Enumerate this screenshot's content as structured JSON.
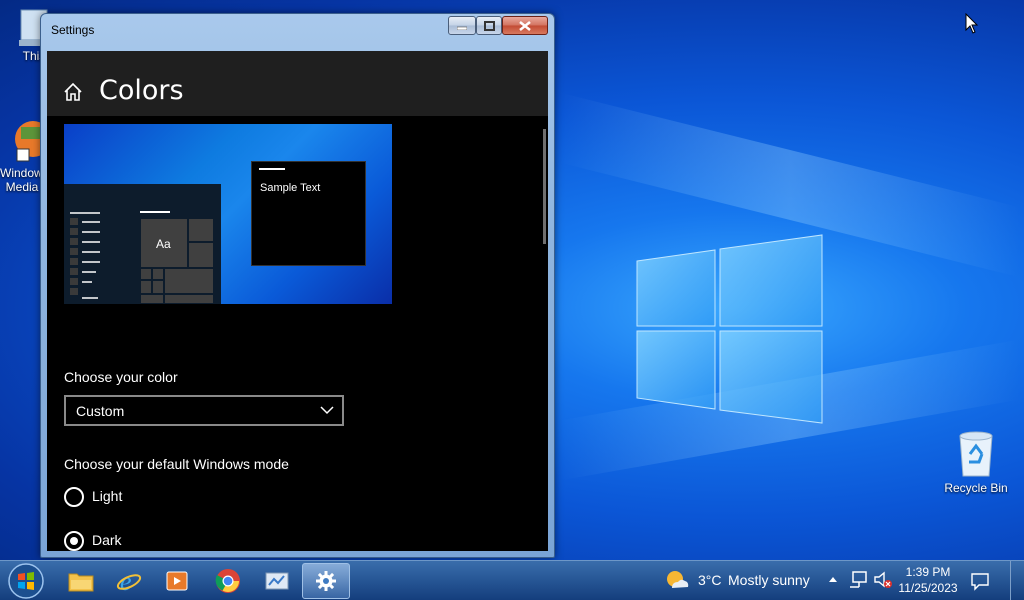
{
  "desktop": {
    "icons": [
      {
        "label": "This",
        "name": "this-pc"
      },
      {
        "label": "Windows Media",
        "name": "windows-media"
      },
      {
        "label": "Recycle Bin",
        "name": "recycle-bin"
      }
    ]
  },
  "window": {
    "title": "Settings",
    "page_title": "Colors",
    "preview": {
      "sample_text": "Sample Text",
      "tile_text": "Aa"
    },
    "choose_color_label": "Choose your color",
    "color_selected": "Custom",
    "mode_label": "Choose your default Windows mode",
    "mode_options": [
      {
        "label": "Light",
        "selected": false
      },
      {
        "label": "Dark",
        "selected": true
      }
    ]
  },
  "taskbar": {
    "apps": [
      "file-explorer",
      "internet-explorer",
      "media-player",
      "chrome",
      "control-panel",
      "settings"
    ],
    "weather": {
      "temp": "3°C",
      "condition": "Mostly sunny"
    },
    "clock": {
      "time": "1:39 PM",
      "date": "11/25/2023"
    }
  },
  "colors": {
    "accent": "#0078d7",
    "window_bg": "#000000",
    "header_bg": "#1f1f1f"
  }
}
